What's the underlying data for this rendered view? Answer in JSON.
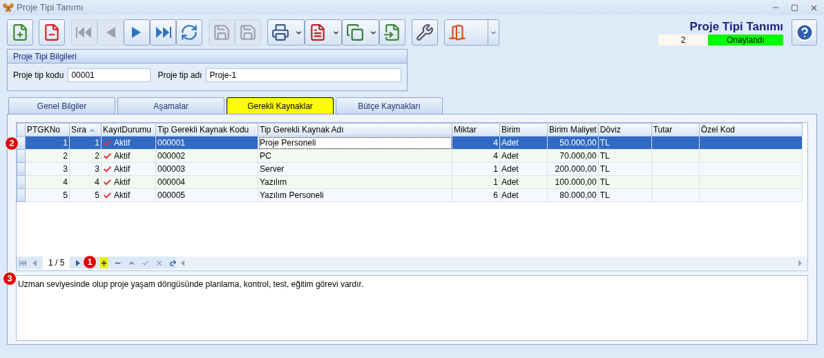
{
  "window": {
    "title": "Proje Tipi Tanımı"
  },
  "toolbar": [
    {
      "kind": "new",
      "disabled": false
    },
    {
      "kind": "delete",
      "disabled": false
    },
    {
      "kind": "first",
      "disabled": true
    },
    {
      "kind": "prev",
      "disabled": true
    },
    {
      "kind": "next",
      "disabled": false
    },
    {
      "kind": "last",
      "disabled": false
    },
    {
      "kind": "refresh",
      "disabled": false
    },
    {
      "kind": "save",
      "disabled": true
    },
    {
      "kind": "cancel",
      "disabled": true
    },
    {
      "kind": "print",
      "disabled": false
    },
    {
      "kind": "pdf",
      "disabled": false
    },
    {
      "kind": "copy",
      "disabled": false
    },
    {
      "kind": "import",
      "disabled": false
    },
    {
      "kind": "tools",
      "disabled": false
    },
    {
      "kind": "exit",
      "disabled": false
    }
  ],
  "header": {
    "title": "Proje Tipi Tanımı",
    "record_no": "2",
    "status": "Onaylandı"
  },
  "info_group": {
    "title": "Proje Tipi Bilgileri",
    "fields": [
      {
        "label": "Proje tip kodu",
        "value": "00001"
      },
      {
        "label": "Proje tip adı",
        "value": "Proje-1"
      }
    ]
  },
  "tabs": [
    {
      "label": "Genel Bilgiler",
      "selected": false
    },
    {
      "label": "Aşamalar",
      "selected": false
    },
    {
      "label": "Gerekli Kaynaklar",
      "selected": true
    },
    {
      "label": "Bütçe Kaynakları",
      "selected": false
    }
  ],
  "table": {
    "callout": "2",
    "columns": [
      {
        "label": "PTGKNo",
        "sorted": false
      },
      {
        "label": "Sıra",
        "sorted": true
      },
      {
        "label": "KayıtDurumu",
        "sorted": false
      },
      {
        "label": "Tip Gerekli Kaynak Kodu",
        "sorted": false
      },
      {
        "label": "Tip Gerekli Kaynak Adı",
        "sorted": false
      },
      {
        "label": "Miktar",
        "sorted": false
      },
      {
        "label": "Birim",
        "sorted": false
      },
      {
        "label": "Birim Maliyet",
        "sorted": false
      },
      {
        "label": "Döviz",
        "sorted": false
      },
      {
        "label": "Tutar",
        "sorted": false
      },
      {
        "label": "Özel Kod",
        "sorted": false
      }
    ],
    "rows": [
      {
        "selected": true,
        "cells": [
          "1",
          "1",
          "Aktif",
          "000001",
          "Proje Personeli",
          "4",
          "Adet",
          "50.000,00",
          "TL",
          "",
          ""
        ]
      },
      {
        "selected": false,
        "cells": [
          "2",
          "2",
          "Aktif",
          "000002",
          "PC",
          "4",
          "Adet",
          "70.000,00",
          "TL",
          "",
          ""
        ]
      },
      {
        "selected": false,
        "cells": [
          "3",
          "3",
          "Aktif",
          "000003",
          "Server",
          "1",
          "Adet",
          "200.000,00",
          "TL",
          "",
          ""
        ]
      },
      {
        "selected": false,
        "cells": [
          "4",
          "4",
          "Aktif",
          "000004",
          "Yazılım",
          "1",
          "Adet",
          "100.000,00",
          "TL",
          "",
          ""
        ]
      },
      {
        "selected": false,
        "cells": [
          "5",
          "5",
          "Aktif",
          "000005",
          "Yazılım Personeli",
          "6",
          "Adet",
          "80.000,00",
          "TL",
          "",
          ""
        ]
      }
    ]
  },
  "navigator": {
    "position": "1 / 5",
    "callout": "1",
    "buttons": [
      {
        "kind": "first",
        "highlighted": false
      },
      {
        "kind": "prev",
        "highlighted": false
      },
      {
        "kind": "next",
        "highlighted": false
      },
      {
        "kind": "add",
        "highlighted": true
      },
      {
        "kind": "remove",
        "highlighted": false
      },
      {
        "kind": "up",
        "highlighted": false
      },
      {
        "kind": "accept",
        "highlighted": false
      },
      {
        "kind": "cancel",
        "highlighted": false
      },
      {
        "kind": "redo",
        "highlighted": false
      }
    ]
  },
  "memo": {
    "callout": "3",
    "text": "Uzman seviyesinde olup proje yaşam döngüsünde planlama, kontrol, test, eğitim görevi vardır."
  }
}
